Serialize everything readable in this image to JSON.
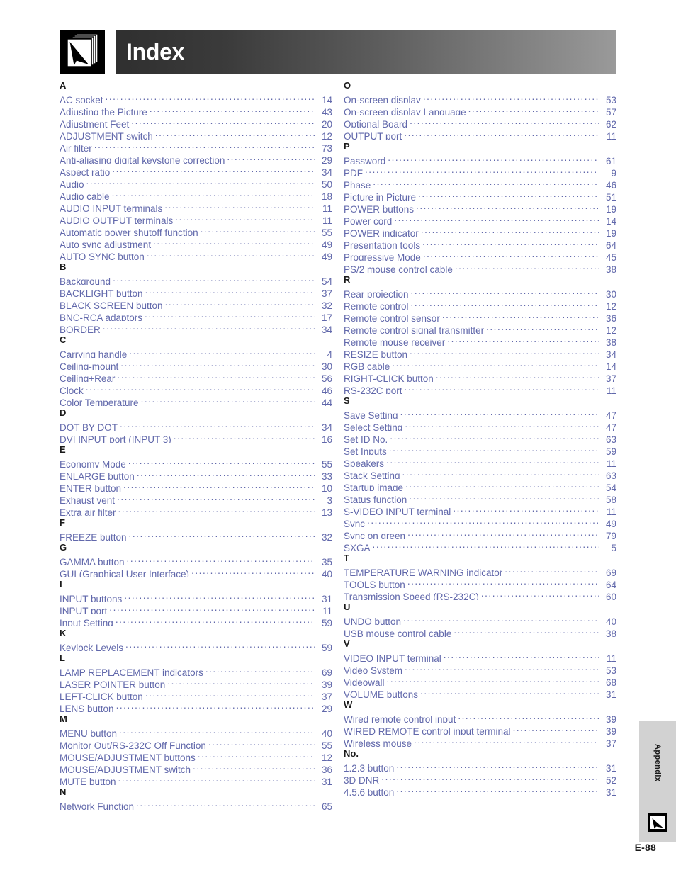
{
  "header": {
    "title": "Index",
    "icon": "index-book-pointer-icon"
  },
  "side_tab": {
    "label": "Appendix",
    "icon": "appendix-arrow-icon"
  },
  "footer": {
    "page_number": "E-88"
  },
  "colors": {
    "entry_text": "#6168ab",
    "section_letter": "#1a1a1a",
    "header_gradient_start": "#2f2f2f",
    "header_gradient_end": "#9a9a9a",
    "tab_background": "#d2d2d2"
  },
  "columns": [
    {
      "name": "left-column",
      "sections": [
        {
          "letter": "A",
          "entries": [
            {
              "label": "AC socket",
              "page": "14"
            },
            {
              "label": "Adjusting the Picture",
              "page": "43"
            },
            {
              "label": "Adjustment Feet",
              "page": "20"
            },
            {
              "label": "ADJUSTMENT switch",
              "page": "12"
            },
            {
              "label": "Air filter",
              "page": "73"
            },
            {
              "label": "Anti-aliasing digital keystone correction",
              "page": "29"
            },
            {
              "label": "Aspect ratio",
              "page": "34"
            },
            {
              "label": "Audio",
              "page": "50"
            },
            {
              "label": "Audio cable",
              "page": "18"
            },
            {
              "label": "AUDIO INPUT terminals",
              "page": "11"
            },
            {
              "label": "AUDIO OUTPUT terminals",
              "page": "11"
            },
            {
              "label": "Automatic power shutoff function",
              "page": "55"
            },
            {
              "label": "Auto sync adjustment",
              "page": "49"
            },
            {
              "label": "AUTO SYNC button",
              "page": "49"
            }
          ]
        },
        {
          "letter": "B",
          "entries": [
            {
              "label": "Background",
              "page": "54"
            },
            {
              "label": "BACKLIGHT button",
              "page": "37"
            },
            {
              "label": "BLACK SCREEN button",
              "page": "32"
            },
            {
              "label": "BNC-RCA adaptors",
              "page": "17"
            },
            {
              "label": "BORDER",
              "page": "34"
            }
          ]
        },
        {
          "letter": "C",
          "entries": [
            {
              "label": "Carrying handle",
              "page": "4"
            },
            {
              "label": "Ceiling-mount",
              "page": "30"
            },
            {
              "label": "Ceiling+Rear",
              "page": "56"
            },
            {
              "label": "Clock",
              "page": "46"
            },
            {
              "label": "Color Temperature",
              "page": "44"
            }
          ]
        },
        {
          "letter": "D",
          "entries": [
            {
              "label": "DOT BY DOT",
              "page": "34"
            },
            {
              "label": "DVI INPUT port (INPUT 3)",
              "page": "16"
            }
          ]
        },
        {
          "letter": "E",
          "entries": [
            {
              "label": "Economy Mode",
              "page": "55"
            },
            {
              "label": "ENLARGE button",
              "page": "33"
            },
            {
              "label": "ENTER button",
              "page": "10"
            },
            {
              "label": "Exhaust vent",
              "page": "3"
            },
            {
              "label": "Extra air filter",
              "page": "13"
            }
          ]
        },
        {
          "letter": "F",
          "entries": [
            {
              "label": "FREEZE button",
              "page": "32"
            }
          ]
        },
        {
          "letter": "G",
          "entries": [
            {
              "label": "GAMMA button",
              "page": "35"
            },
            {
              "label": "GUI (Graphical User Interface)",
              "page": "40"
            }
          ]
        },
        {
          "letter": "I",
          "entries": [
            {
              "label": "INPUT buttons",
              "page": "31"
            },
            {
              "label": "INPUT port",
              "page": "11"
            },
            {
              "label": "Input Setting",
              "page": "59"
            }
          ]
        },
        {
          "letter": "K",
          "entries": [
            {
              "label": "Keylock Levels",
              "page": "59"
            }
          ]
        },
        {
          "letter": "L",
          "entries": [
            {
              "label": "LAMP REPLACEMENT indicators",
              "page": "69"
            },
            {
              "label": "LASER POINTER button",
              "page": "39"
            },
            {
              "label": "LEFT-CLICK button",
              "page": "37"
            },
            {
              "label": "LENS button",
              "page": "29"
            }
          ]
        },
        {
          "letter": "M",
          "entries": [
            {
              "label": "MENU button",
              "page": "40"
            },
            {
              "label": "Monitor Out/RS-232C Off Function",
              "page": "55"
            },
            {
              "label": "MOUSE/ADJUSTMENT buttons",
              "page": "12"
            },
            {
              "label": "MOUSE/ADJUSTMENT switch",
              "page": "36"
            },
            {
              "label": "MUTE button",
              "page": "31"
            }
          ]
        },
        {
          "letter": "N",
          "entries": [
            {
              "label": "Network Function",
              "page": "65"
            }
          ]
        }
      ]
    },
    {
      "name": "right-column",
      "sections": [
        {
          "letter": "O",
          "entries": [
            {
              "label": "On-screen display",
              "page": "53"
            },
            {
              "label": "On-screen display Language",
              "page": "57"
            },
            {
              "label": "Optional Board",
              "page": "62"
            },
            {
              "label": "OUTPUT port",
              "page": "11"
            }
          ]
        },
        {
          "letter": "P",
          "entries": [
            {
              "label": "Password",
              "page": "61"
            },
            {
              "label": "PDF",
              "page": "9"
            },
            {
              "label": "Phase",
              "page": "46"
            },
            {
              "label": "Picture in Picture",
              "page": "51"
            },
            {
              "label": "POWER buttons",
              "page": "19"
            },
            {
              "label": "Power cord",
              "page": "14"
            },
            {
              "label": "POWER indicator",
              "page": "19"
            },
            {
              "label": "Presentation tools",
              "page": "64"
            },
            {
              "label": "Progressive Mode",
              "page": "45"
            },
            {
              "label": "PS/2 mouse control cable",
              "page": "38"
            }
          ]
        },
        {
          "letter": "R",
          "entries": [
            {
              "label": "Rear projection",
              "page": "30"
            },
            {
              "label": "Remote control",
              "page": "12"
            },
            {
              "label": "Remote control sensor",
              "page": "36"
            },
            {
              "label": "Remote control signal transmitter",
              "page": "12"
            },
            {
              "label": "Remote mouse receiver",
              "page": "38"
            },
            {
              "label": "RESIZE button",
              "page": "34"
            },
            {
              "label": "RGB cable",
              "page": "14"
            },
            {
              "label": "RIGHT-CLICK button",
              "page": "37"
            },
            {
              "label": "RS-232C port",
              "page": "11"
            }
          ]
        },
        {
          "letter": "S",
          "entries": [
            {
              "label": "Save Setting",
              "page": "47"
            },
            {
              "label": "Select Setting",
              "page": "47"
            },
            {
              "label": "Set ID No.",
              "page": "63"
            },
            {
              "label": "Set Inputs",
              "page": "59"
            },
            {
              "label": "Speakers",
              "page": "11"
            },
            {
              "label": "Stack Setting",
              "page": "63"
            },
            {
              "label": "Startup image",
              "page": "54"
            },
            {
              "label": "Status function",
              "page": "58"
            },
            {
              "label": "S-VIDEO INPUT terminal",
              "page": "11"
            },
            {
              "label": "Sync",
              "page": "49"
            },
            {
              "label": "Sync on green",
              "page": "79"
            },
            {
              "label": "SXGA",
              "page": "5"
            }
          ]
        },
        {
          "letter": "T",
          "entries": [
            {
              "label": "TEMPERATURE WARNING indicator",
              "page": "69"
            },
            {
              "label": "TOOLS button",
              "page": "64"
            },
            {
              "label": "Transmission Speed (RS-232C)",
              "page": "60"
            }
          ]
        },
        {
          "letter": "U",
          "entries": [
            {
              "label": "UNDO button",
              "page": "40"
            },
            {
              "label": "USB mouse control cable",
              "page": "38"
            }
          ]
        },
        {
          "letter": "V",
          "entries": [
            {
              "label": "VIDEO INPUT terminal",
              "page": "11"
            },
            {
              "label": "Video System",
              "page": "53"
            },
            {
              "label": "Videowall",
              "page": "68"
            },
            {
              "label": "VOLUME buttons",
              "page": "31"
            }
          ]
        },
        {
          "letter": "W",
          "entries": [
            {
              "label": "Wired remote control input",
              "page": "39"
            },
            {
              "label": "WIRED REMOTE control input terminal",
              "page": "39"
            },
            {
              "label": "Wireless mouse",
              "page": "37"
            }
          ]
        },
        {
          "letter": "No.",
          "entries": [
            {
              "label": "1.2.3 button",
              "page": "31"
            },
            {
              "label": "3D DNR",
              "page": "52"
            },
            {
              "label": "4.5.6 button",
              "page": "31"
            }
          ]
        }
      ]
    }
  ]
}
